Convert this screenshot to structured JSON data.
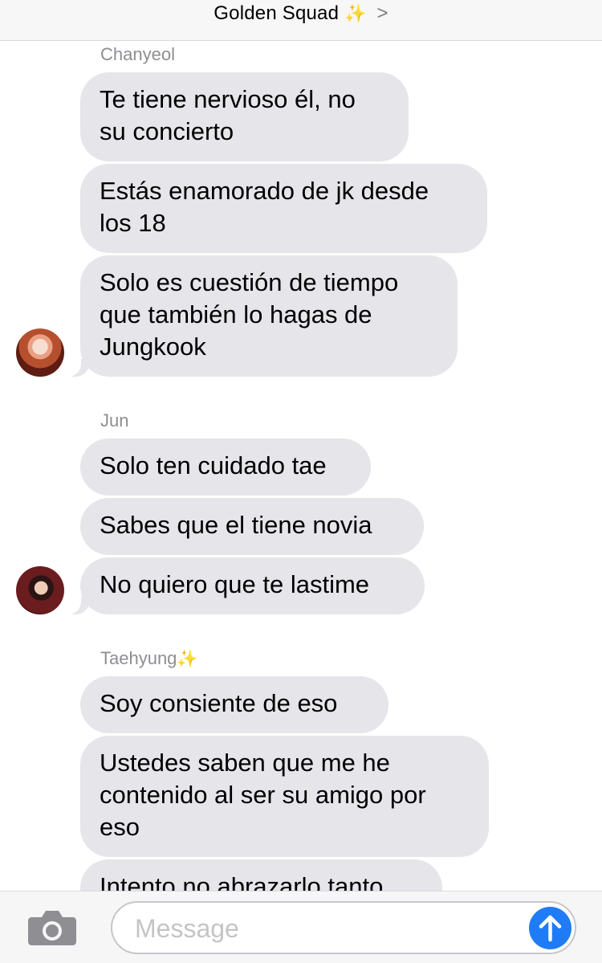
{
  "header": {
    "title": "Golden Squad",
    "sparkle": "✨",
    "chevron": ">"
  },
  "groups": [
    {
      "sender": "Chanyeol",
      "messages": [
        "Te tiene nervioso él, no\nsu concierto",
        "Estás enamorado de jk desde\nlos 18",
        "Solo es cuestión de tiempo\nque también lo hagas de\nJungkook"
      ],
      "avatar_icon": "chanyeol-avatar"
    },
    {
      "sender": "Jun",
      "messages": [
        "Solo ten cuidado tae",
        "Sabes que el tiene novia",
        "No quiero que te lastime"
      ],
      "avatar_icon": "jun-avatar"
    },
    {
      "sender": "Taehyung",
      "sender_emoji": "✨",
      "messages": [
        "Soy consiente de eso",
        "Ustedes saben que me he\ncontenido al ser su amigo por\neso",
        "Intento no abrazarlo tanto"
      ]
    }
  ],
  "composer": {
    "placeholder": "Message",
    "camera_icon": "camera-icon",
    "send_icon": "send-arrow-icon",
    "send_color": "#1f7cf6"
  },
  "colors": {
    "bubble": "#e5e5ea",
    "sender_name": "#8e8e93"
  }
}
